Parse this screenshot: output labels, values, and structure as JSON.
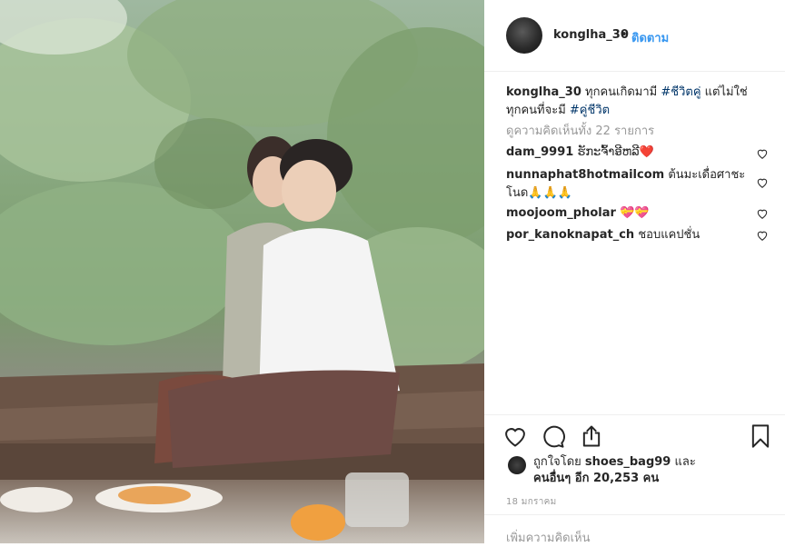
{
  "post": {
    "username": "konglha_30",
    "follow_label": "ติดตาม",
    "separator": "•",
    "caption_text": " ทุกคนเกิดมามี ",
    "caption_tag1": "#ชีวิตคู่",
    "caption_text2": " แต่ไม่ใช่ทุกคนที่จะมี ",
    "caption_tag2": "#คู่ชีวิต",
    "view_all": "ดูความคิดเห็นทั้ง 22 รายการ"
  },
  "comments": [
    {
      "user": "dam_9991",
      "text": " ຮັກະຈົ້າອີຫລີ❤️"
    },
    {
      "user": "nunnaphat8hotmailcom",
      "text": " ต้นมะเดื่อศาชะโนด🙏🙏🙏"
    },
    {
      "user": "moojoom_pholar",
      "text": " 💝💝"
    },
    {
      "user": "por_kanoknapat_ch",
      "text": " ชอบแคปชั่น"
    }
  ],
  "likes": {
    "prefix": "ถูกใจโดย ",
    "liker": "shoes_bag99",
    "mid": " และ",
    "others": "คนอื่นๆ อีก 20,253 คน"
  },
  "date": "18 มกราคม",
  "add_comment_placeholder": "เพิ่มความคิดเห็น"
}
